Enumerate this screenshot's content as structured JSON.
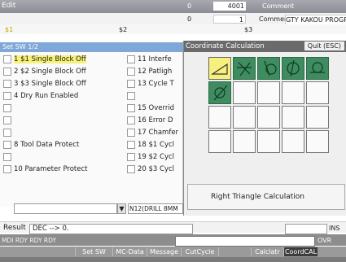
{
  "header": {
    "title": "Edit",
    "field0": "0",
    "program_no": "4001",
    "comment_tag1": "Comment",
    "line2_zero": "0",
    "line2_one": "1",
    "comment_tag2": "Comment",
    "comment_text": "GTY KAKOU PROGRAM"
  },
  "tabs": {
    "t1": "$1",
    "t2": "$2",
    "t3": "$3"
  },
  "setsw": {
    "title": "Set SW 1/2",
    "left_items": [
      {
        "label": "1 $1 Single Block Off",
        "selected": true
      },
      {
        "label": "2 $2 Single Block Off"
      },
      {
        "label": "3 $3 Single Block Off"
      },
      {
        "label": "4 Dry Run Enabled"
      },
      {
        "label": ""
      },
      {
        "label": ""
      },
      {
        "label": ""
      },
      {
        "label": "8 Tool Data Protect"
      },
      {
        "label": ""
      },
      {
        "label": "10 Parameter Protect"
      }
    ],
    "right_items": [
      {
        "label": "11 Interfe"
      },
      {
        "label": "12 Patligh"
      },
      {
        "label": "13 Cycle T"
      },
      {
        "label": ""
      },
      {
        "label": "15 Overrid"
      },
      {
        "label": "16 Error D"
      },
      {
        "label": "17 Chamfer"
      },
      {
        "label": "18 $1 Cycl"
      },
      {
        "label": "19 $2 Cycl"
      },
      {
        "label": "20 $3 Cycl"
      }
    ]
  },
  "dialog": {
    "title": "Coordinate Calculation",
    "quit": "Quit (ESC)",
    "description": "Right Triangle Calculation"
  },
  "bottom": {
    "dropdown_arrow": "▼",
    "dropdown2": "N12(DRILL 8MM",
    "result_label": "Result",
    "result_value": "DEC --> 0.",
    "ins": "INS",
    "status": "MDI  RDY  RDY  RDY",
    "ovr": "OVR"
  },
  "softkeys": [
    "Set SW",
    "MC-Data",
    "Message",
    "CutCycle",
    "",
    "Calclatr",
    "CoordCAL"
  ],
  "colors": {
    "accent_green": "#3e8c60",
    "selected_yellow": "#f7f07c",
    "header_blue": "#7fa8d8"
  }
}
